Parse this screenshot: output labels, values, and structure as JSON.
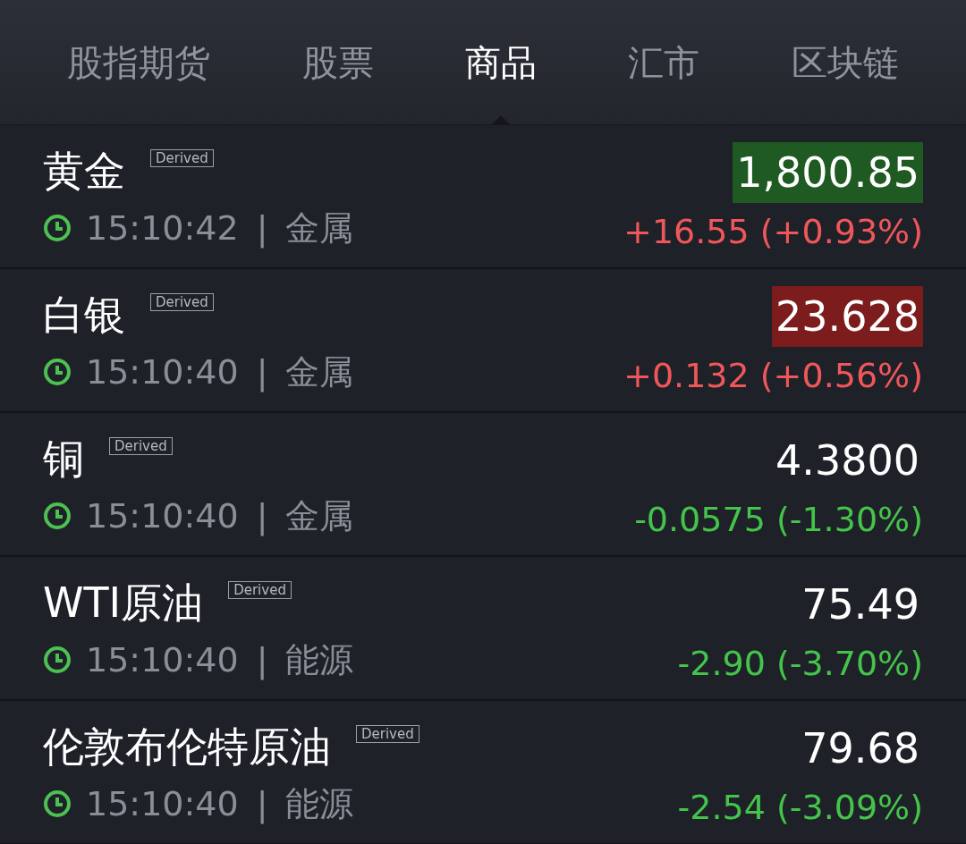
{
  "tabs": [
    {
      "label": "股指期货",
      "selected": false
    },
    {
      "label": "股票",
      "selected": false
    },
    {
      "label": "商品",
      "selected": true
    },
    {
      "label": "汇市",
      "selected": false
    },
    {
      "label": "区块链",
      "selected": false
    }
  ],
  "rows": [
    {
      "name": "黄金",
      "badge": "Derived",
      "time": "15:10:42",
      "separator": "|",
      "category": "金属",
      "price": "1,800.85",
      "color": "#1e5a22",
      "change": "+16.55 (+0.93%)",
      "rising": true
    },
    {
      "name": "白银",
      "badge": "Derived",
      "time": "15:10:40",
      "separator": "|",
      "category": "金属",
      "price": "23.628",
      "color": "#7c1c1c",
      "change": "+0.132 (+0.56%)",
      "rising": true
    },
    {
      "name": "铜",
      "badge": "Derived",
      "time": "15:10:40",
      "separator": "|",
      "category": "金属",
      "price": "4.3800",
      "change": "-0.0575 (-1.30%)",
      "rising": false
    },
    {
      "name": "WTI原油",
      "badge": "Derived",
      "time": "15:10:40",
      "separator": "|",
      "category": "能源",
      "price": "75.49",
      "change": "-2.90 (-3.70%)",
      "rising": false
    },
    {
      "name": "伦敦布伦特原油",
      "badge": "Derived",
      "time": "15:10:40",
      "separator": "|",
      "category": "能源",
      "price": "79.68",
      "change": "-2.54 (-3.09%)",
      "rising": false
    }
  ]
}
